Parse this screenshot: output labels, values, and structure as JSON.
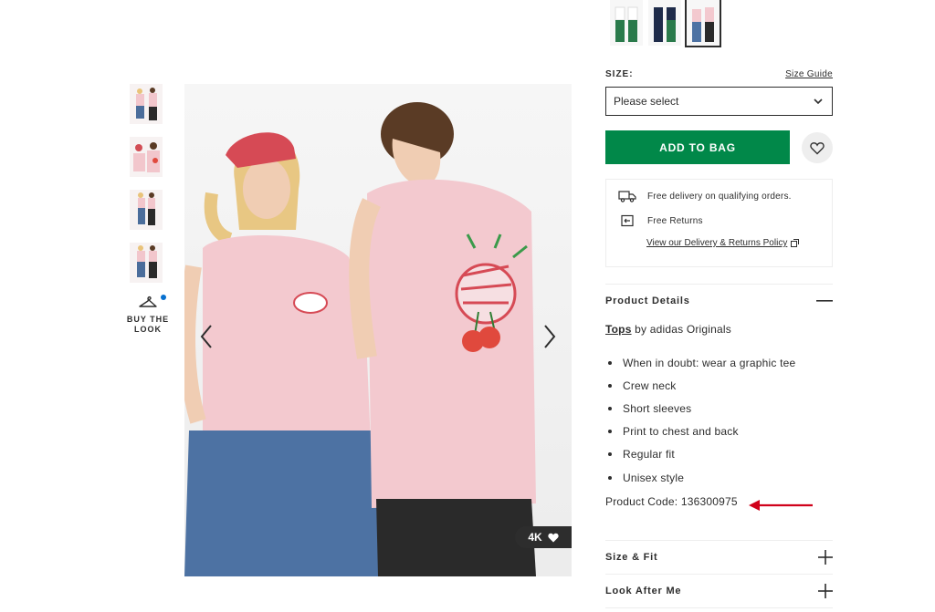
{
  "gallery": {
    "thumbnails": [
      "thumb-1",
      "thumb-2",
      "thumb-3",
      "thumb-4"
    ],
    "buy_the_look": "BUY THE LOOK",
    "badge_label": "4K"
  },
  "colour_swatches": [
    "swatch-1",
    "swatch-2",
    "swatch-3"
  ],
  "size": {
    "label": "SIZE:",
    "guide_link": "Size Guide",
    "select_value": "Please select"
  },
  "actions": {
    "add_to_bag": "ADD TO BAG"
  },
  "delivery": {
    "free_delivery": "Free delivery on qualifying orders.",
    "free_returns": "Free Returns",
    "policy_link": "View our Delivery & Returns Policy"
  },
  "product_details": {
    "title": "Product Details",
    "category_link": "Tops",
    "brand_text": " by adidas Originals",
    "bullets": [
      "When in doubt: wear a graphic tee",
      "Crew neck",
      "Short sleeves",
      "Print to chest and back",
      "Regular fit",
      "Unisex style"
    ],
    "product_code": "Product Code: 136300975"
  },
  "sections": {
    "size_fit": "Size & Fit",
    "look_after_me": "Look After Me"
  },
  "colors": {
    "brand_green": "#018849",
    "annotation_red": "#d0021b",
    "dark": "#2d2d2d"
  },
  "icons": {
    "prev": "chevron-left-icon",
    "next": "chevron-right-icon",
    "save": "heart-icon",
    "delivery": "truck-icon",
    "returns": "returns-icon",
    "external": "external-link-icon",
    "collapse": "minus-icon",
    "expand": "plus-icon",
    "hanger": "hanger-icon",
    "select": "chevron-down-icon"
  }
}
